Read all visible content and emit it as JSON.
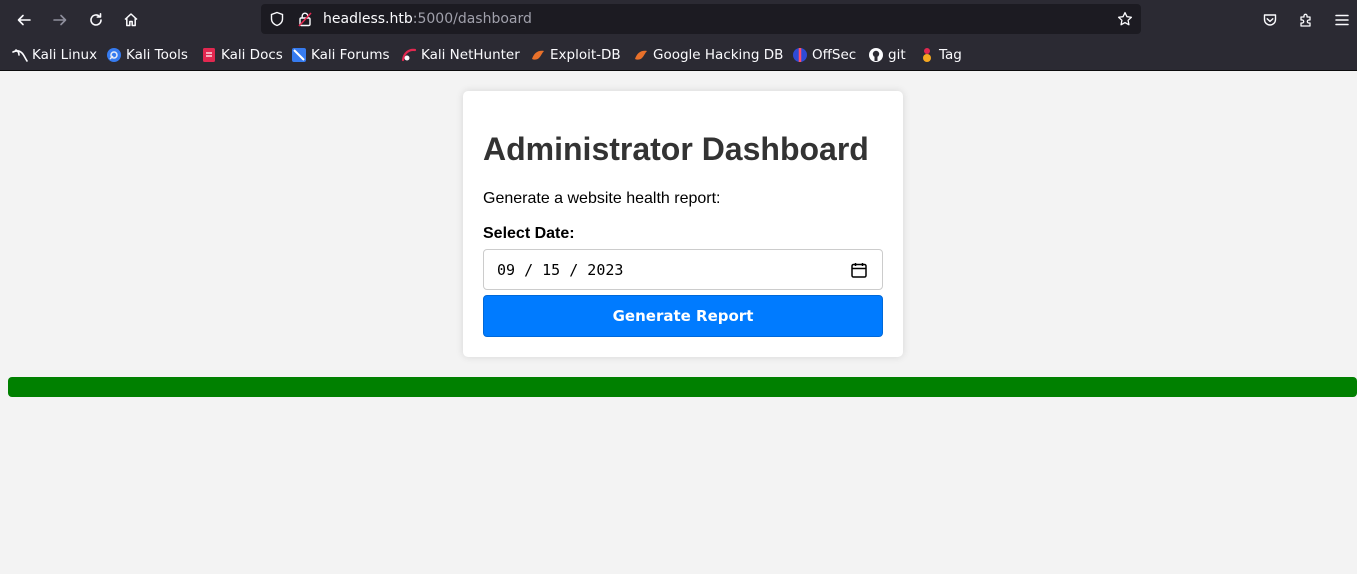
{
  "browser": {
    "url": {
      "host": "headless.htb",
      "rest": ":5000/dashboard"
    },
    "bookmarks": [
      {
        "label": "Kali Linux",
        "icon": "kali-dragon-icon"
      },
      {
        "label": "Kali Tools",
        "icon": "kali-tools-icon"
      },
      {
        "label": "Kali Docs",
        "icon": "kali-docs-icon"
      },
      {
        "label": "Kali Forums",
        "icon": "kali-forums-icon"
      },
      {
        "label": "Kali NetHunter",
        "icon": "kali-nethunter-icon"
      },
      {
        "label": "Exploit-DB",
        "icon": "exploit-db-icon"
      },
      {
        "label": "Google Hacking DB",
        "icon": "ghdb-icon"
      },
      {
        "label": "OffSec",
        "icon": "offsec-icon"
      },
      {
        "label": "git",
        "icon": "github-icon"
      },
      {
        "label": "Tag",
        "icon": "tag-icon"
      }
    ]
  },
  "page": {
    "title": "Administrator Dashboard",
    "subtitle": "Generate a website health report:",
    "date_label": "Select Date:",
    "date_value": "09 / 15 / 2023",
    "button_label": "Generate Report",
    "progress": {
      "percent": 100,
      "color": "#008000"
    },
    "accent": "#007bff"
  }
}
